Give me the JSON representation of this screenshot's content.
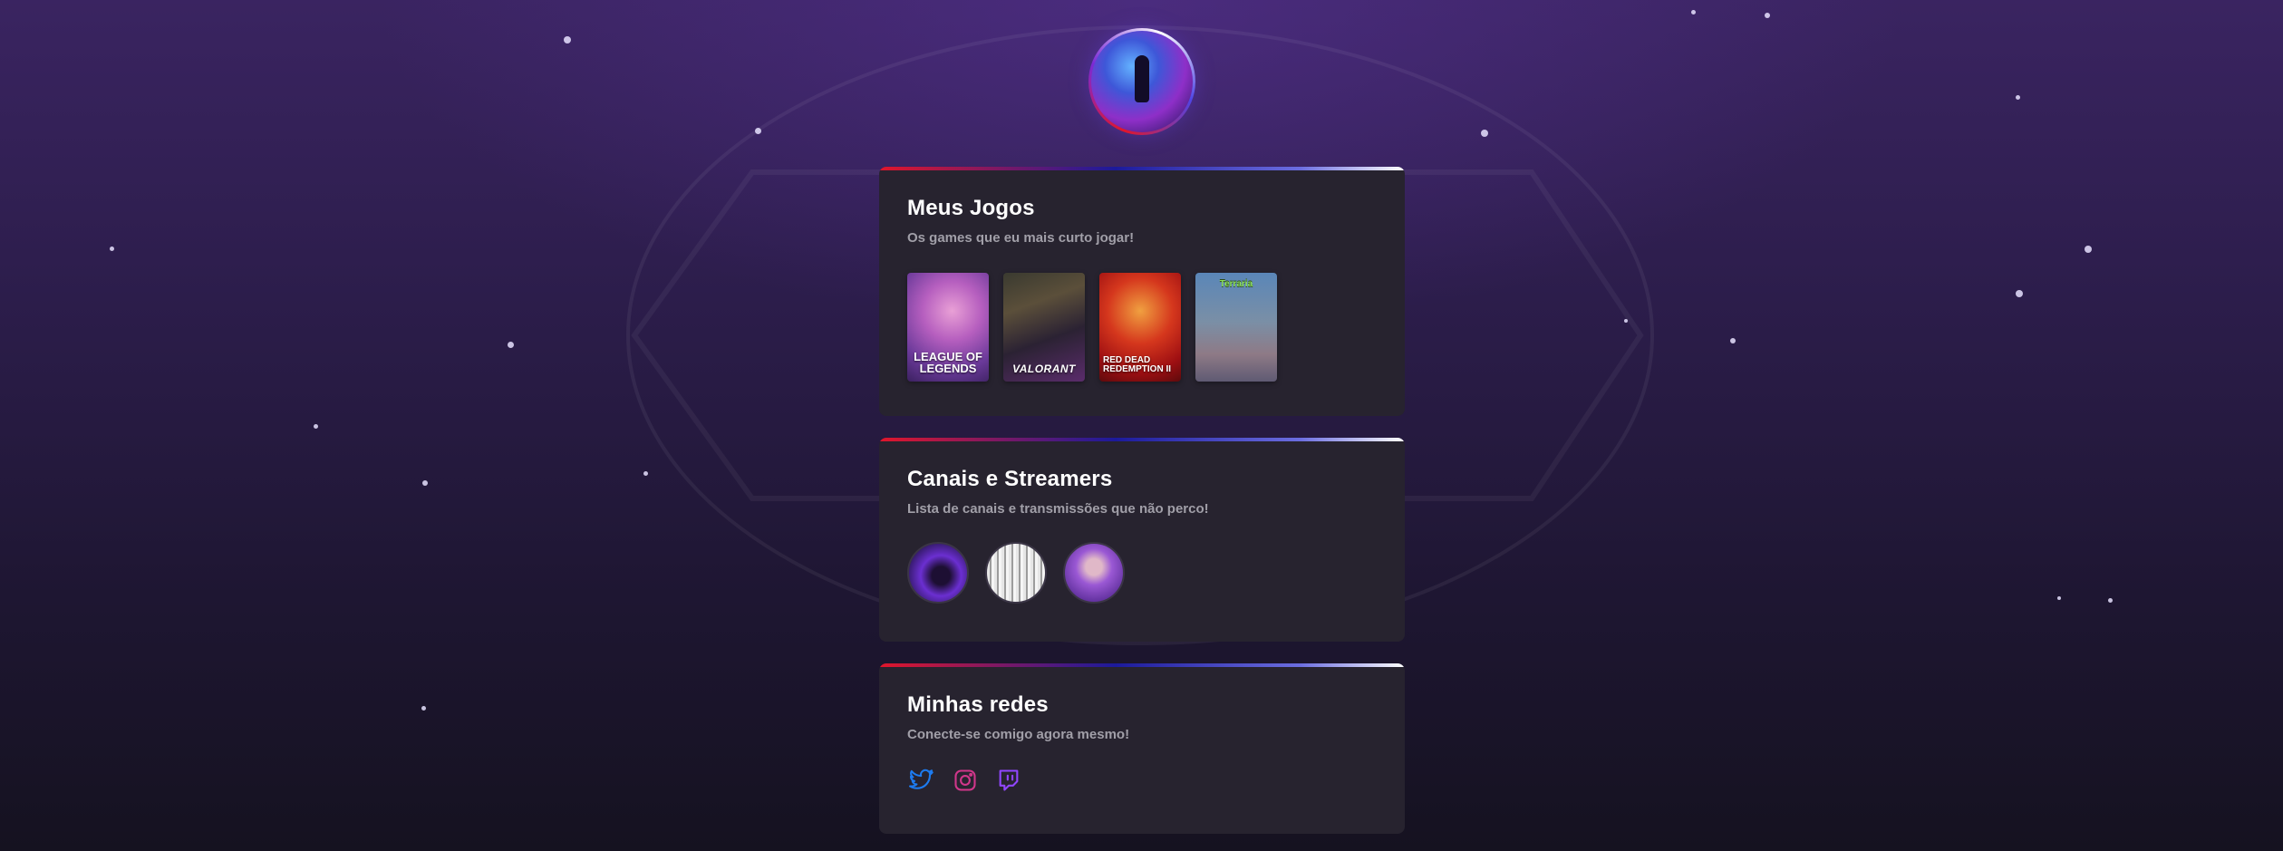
{
  "colors": {
    "accent_red": "#e0162b",
    "accent_blue": "#1c1a9b",
    "card_bg": "#27232f",
    "subtitle_gray": "#a19fa8",
    "twitter_icon": "#1d7bf0",
    "instagram_icon": "#c13584",
    "twitch_icon": "#9146ff"
  },
  "profile": {
    "avatar_icon": "avatar-image"
  },
  "games_section": {
    "title": "Meus Jogos",
    "subtitle": "Os games que eu mais curto jogar!",
    "games": [
      {
        "name": "League of Legends"
      },
      {
        "name": "Valorant"
      },
      {
        "name": "Red Dead Redemption II"
      },
      {
        "name": "Terraria"
      }
    ]
  },
  "streamers_section": {
    "title": "Canais e Streamers",
    "subtitle": "Lista de canais e transmissões que não perco!",
    "streamers": [
      {
        "icon": "streamer-avatar"
      },
      {
        "icon": "streamer-avatar"
      },
      {
        "icon": "streamer-avatar"
      }
    ]
  },
  "social_section": {
    "title": "Minhas redes",
    "subtitle": "Conecte-se comigo agora mesmo!",
    "links": [
      {
        "icon": "twitter-icon"
      },
      {
        "icon": "instagram-icon"
      },
      {
        "icon": "twitch-icon"
      }
    ]
  }
}
